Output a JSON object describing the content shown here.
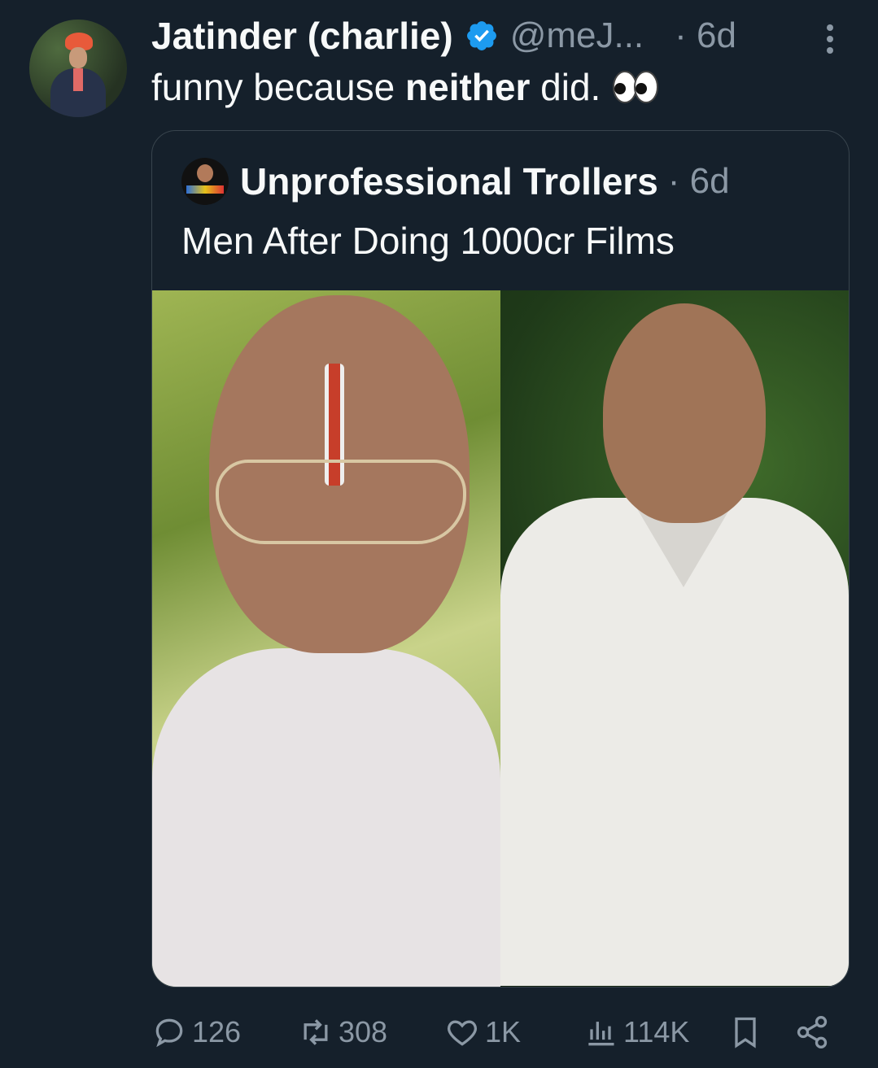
{
  "tweet": {
    "author": {
      "display_name": "Jatinder (charlie)",
      "handle": "@meJ...",
      "verified": true,
      "avatar_icon": "profile-photo"
    },
    "time": "· 6d",
    "text": {
      "before": "funny because ",
      "bold": "neither",
      "after": " did.",
      "emoji": "eyes-emoji"
    },
    "more_icon": "vertical-dots-icon"
  },
  "quoted_tweet": {
    "author": {
      "display_name": "Unprofessional Trollers",
      "avatar_icon": "profile-photo"
    },
    "time": "· 6d",
    "text": "Men After Doing 1000cr Films",
    "media": {
      "layout": "two-photos-side-by-side"
    }
  },
  "actions": {
    "replies": "126",
    "retweets": "308",
    "likes": "1K",
    "views": "114K",
    "icons": [
      "reply-icon",
      "retweet-icon",
      "like-icon",
      "views-icon",
      "bookmark-icon",
      "share-icon"
    ]
  },
  "colors": {
    "background": "#15202b",
    "text_primary": "#f7f9f9",
    "text_secondary": "#8b98a5",
    "border": "#38444d",
    "verified": "#1d9bf0"
  }
}
